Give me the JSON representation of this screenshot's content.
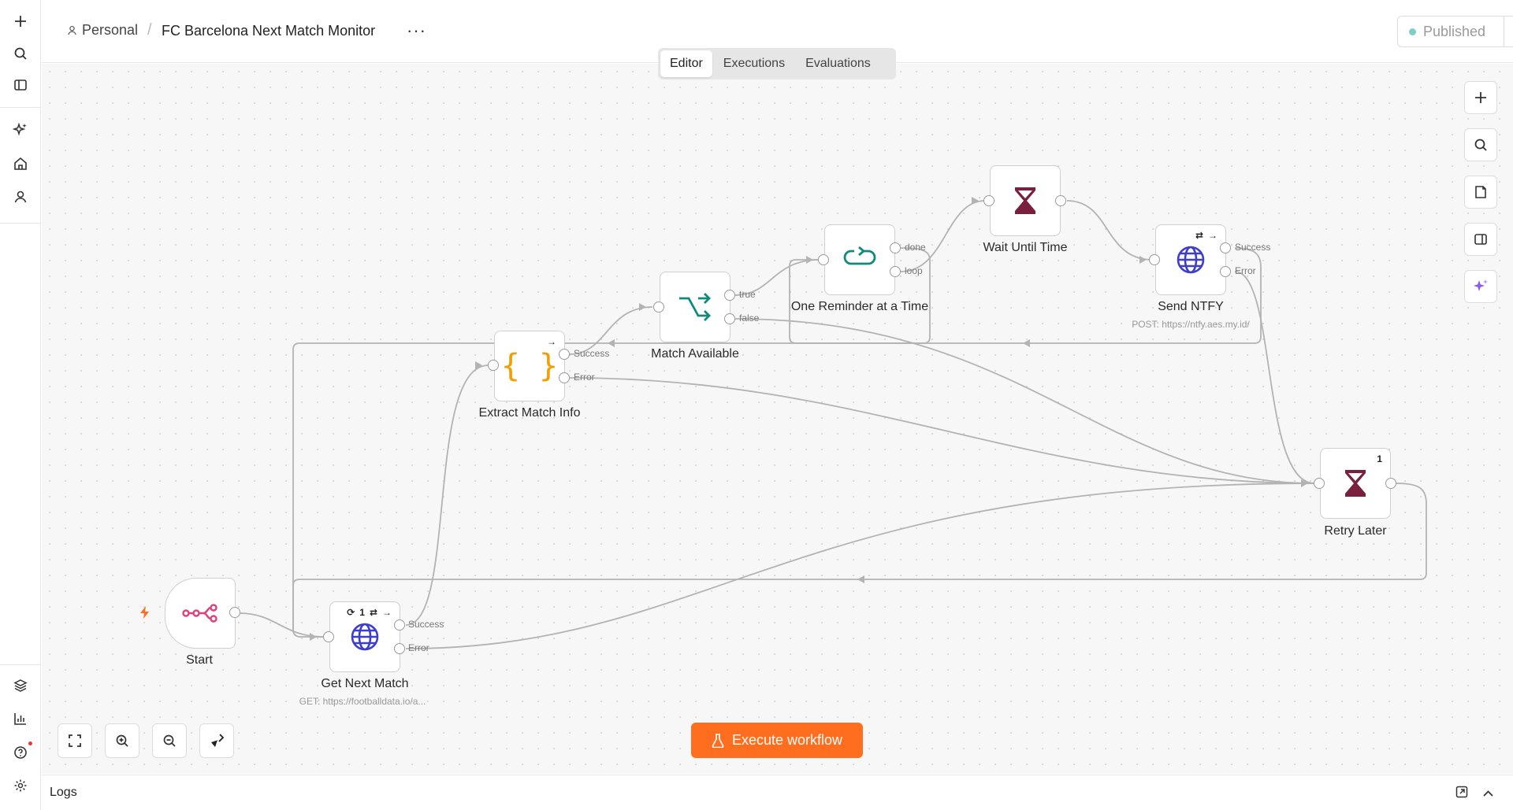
{
  "header": {
    "project": "Personal",
    "workflow_title": "FC Barcelona Next Match Monitor",
    "more_label": "···",
    "status": "Published"
  },
  "tabs": [
    {
      "label": "Editor",
      "active": true
    },
    {
      "label": "Executions",
      "active": false
    },
    {
      "label": "Evaluations",
      "active": false
    }
  ],
  "sidebar": {
    "items": [
      {
        "name": "add-icon"
      },
      {
        "name": "search-icon"
      },
      {
        "name": "panel-toggle-icon"
      },
      {
        "name": "sparkles-icon"
      },
      {
        "name": "home-icon"
      },
      {
        "name": "user-icon"
      },
      {
        "name": "templates-icon"
      },
      {
        "name": "insights-icon"
      },
      {
        "name": "help-icon"
      },
      {
        "name": "settings-icon"
      }
    ]
  },
  "nodes": {
    "start": {
      "label": "Start"
    },
    "get_next_match": {
      "label": "Get Next Match",
      "subtitle": "GET: https://footballdata.io/a...",
      "badges": "1"
    },
    "extract_match_info": {
      "label": "Extract Match Info"
    },
    "match_available": {
      "label": "Match Available"
    },
    "one_reminder": {
      "label": "One Reminder at a Time"
    },
    "wait_until_time": {
      "label": "Wait Until Time"
    },
    "send_ntfy": {
      "label": "Send NTFY",
      "subtitle": "POST: https://ntfy.aes.my.id/"
    },
    "retry_later": {
      "label": "Retry Later",
      "badge": "1"
    }
  },
  "ports": {
    "success": "Success",
    "error": "Error",
    "true": "true",
    "false": "false",
    "done": "done",
    "loop": "loop"
  },
  "execute": {
    "label": "Execute workflow"
  },
  "logs": {
    "label": "Logs"
  },
  "colors": {
    "accent": "#ff6d1f",
    "http_icon": "#3e3ecc",
    "switch_icon": "#0f8b79",
    "wait_icon": "#7a1f3d",
    "code_icon": "#f0a000",
    "trigger_icon": "#e0407a"
  }
}
